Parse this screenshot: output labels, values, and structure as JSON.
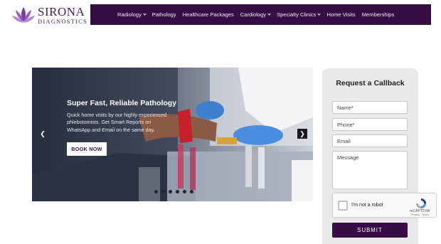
{
  "brand": {
    "name": "SIRONA",
    "subtitle": "DIAGNOSTICS",
    "logo_icon": "lotus-icon",
    "color": "#3e2358"
  },
  "nav": {
    "background": "#370d45",
    "items": [
      {
        "label": "Radiology",
        "has_dropdown": true
      },
      {
        "label": "Pathology",
        "has_dropdown": false
      },
      {
        "label": "Healthcare Packages",
        "has_dropdown": false
      },
      {
        "label": "Cardiology",
        "has_dropdown": true
      },
      {
        "label": "Specialty Clinics",
        "has_dropdown": true
      },
      {
        "label": "Home Visits",
        "has_dropdown": false
      },
      {
        "label": "Memberships",
        "has_dropdown": false
      }
    ]
  },
  "slider": {
    "title": "Super Fast, Reliable Pathology",
    "text": "Quick home visits by our highly experienced phlebotomists. Get Smart Reports on WhatsApp and Email on the same day.",
    "button": "BOOK NOW",
    "prev_icon": "chevron-left-icon",
    "next_icon": "chevron-right-icon",
    "dot_count": 6,
    "active_dot": 0
  },
  "callback": {
    "title": "Request a Callback",
    "fields": {
      "name": "Name*",
      "phone": "Phone*",
      "email": "Email",
      "message": "Message"
    },
    "captcha": {
      "label": "I'm not a robot",
      "brand": "reCAPTCHA",
      "terms": "Privacy - Terms"
    },
    "submit": "SUBMIT"
  }
}
